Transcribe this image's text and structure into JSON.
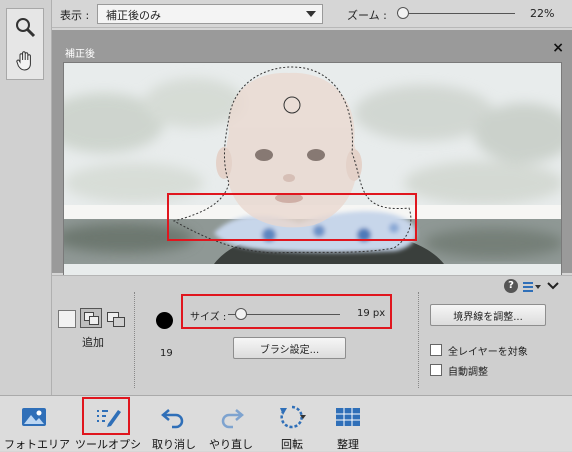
{
  "topbar": {
    "view_label": "表示 :",
    "view_value": "補正後のみ",
    "zoom_label": "ズーム :",
    "zoom_value": "22%"
  },
  "preview": {
    "title": "補正後",
    "close_glyph": "×"
  },
  "options": {
    "mode_label": "追加",
    "brush_size_number": "19",
    "size_label": "サイズ :",
    "size_value": "19 px",
    "brush_settings_button": "ブラシ設定...",
    "refine_edge_button": "境界線を調整...",
    "sample_all_layers": "全レイヤーを対象",
    "auto_enhance": "自動調整",
    "help_glyph": "?",
    "sample_all_checked": false,
    "auto_enhance_checked": false
  },
  "bottombar": {
    "items": [
      {
        "label": "フォトエリア",
        "icon": "photo-bin-icon"
      },
      {
        "label": "ツールオプシ",
        "icon": "tool-options-icon"
      },
      {
        "label": "取り消し",
        "icon": "undo-icon"
      },
      {
        "label": "やり直し",
        "icon": "redo-icon"
      },
      {
        "label": "回転",
        "icon": "rotate-icon"
      },
      {
        "label": "整理",
        "icon": "organize-icon"
      }
    ]
  },
  "colors": {
    "accent_blue": "#2f6fb8",
    "highlight_red": "#e0161e"
  }
}
